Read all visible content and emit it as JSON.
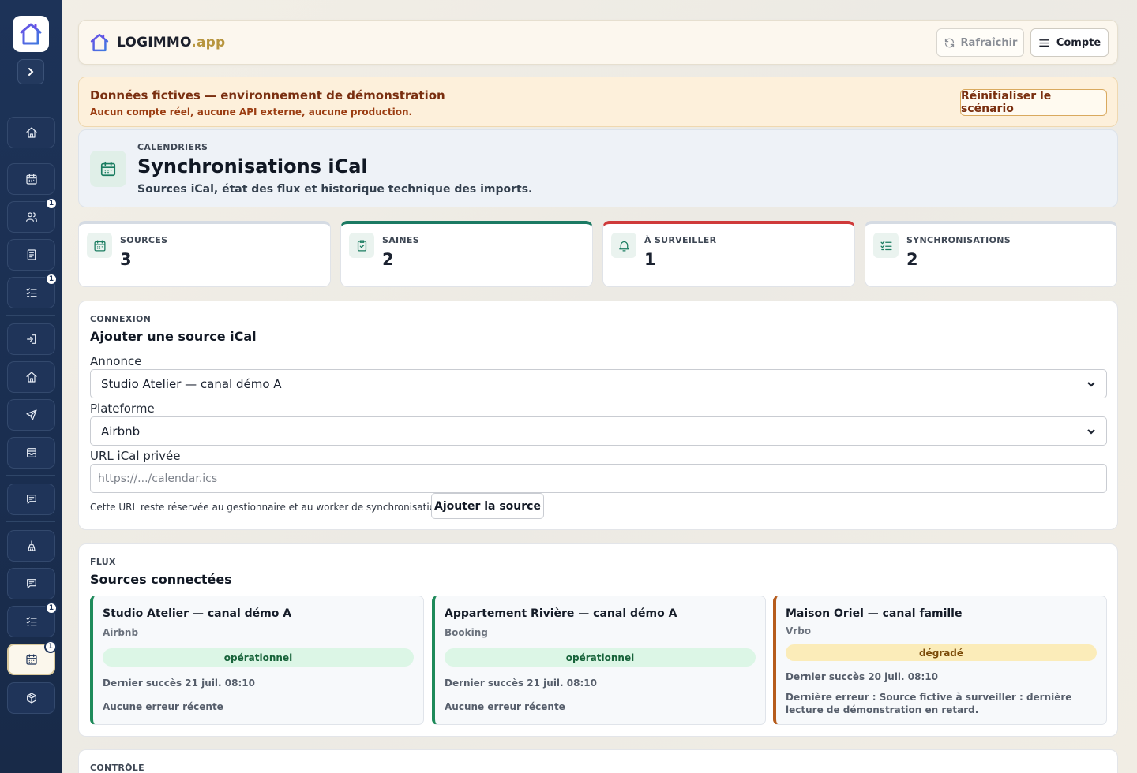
{
  "app": {
    "brand_main": "LOGIMMO",
    "brand_suffix": ".app"
  },
  "header": {
    "refresh_label": "Rafraîchir",
    "account_label": "Compte"
  },
  "sidebar": {
    "items": [
      {
        "icon": "home-icon",
        "badge": ""
      },
      {
        "icon": "calendar-icon",
        "badge": ""
      },
      {
        "icon": "users-icon",
        "badge": "1"
      },
      {
        "icon": "document-icon",
        "badge": ""
      },
      {
        "icon": "checklist-icon",
        "badge": "1"
      },
      {
        "icon": "login-icon",
        "badge": ""
      },
      {
        "icon": "home-icon",
        "badge": ""
      },
      {
        "icon": "send-icon",
        "badge": ""
      },
      {
        "icon": "inbox-icon",
        "badge": ""
      },
      {
        "icon": "message-icon",
        "badge": ""
      },
      {
        "icon": "cleaning-icon",
        "badge": ""
      },
      {
        "icon": "message-icon",
        "badge": ""
      },
      {
        "icon": "checklist-icon",
        "badge": "1"
      },
      {
        "icon": "calendar-icon",
        "badge": "1",
        "active": true
      },
      {
        "icon": "package-icon",
        "badge": ""
      }
    ]
  },
  "demo": {
    "title": "Données fictives — environnement de démonstration",
    "subtitle": "Aucun compte réel, aucune API externe, aucune production.",
    "reset_label": "Réinitialiser le scénario"
  },
  "page": {
    "eyebrow": "CALENDRIERS",
    "title": "Synchronisations iCal",
    "description": "Sources iCal, état des flux et historique technique des imports."
  },
  "stats": [
    {
      "label": "SOURCES",
      "value": "3",
      "icon": "calendar-icon"
    },
    {
      "label": "SAINES",
      "value": "2",
      "icon": "clipboard-check-icon"
    },
    {
      "label": "À SURVEILLER",
      "value": "1",
      "icon": "bell-icon"
    },
    {
      "label": "SYNCHRONISATIONS",
      "value": "2",
      "icon": "checklist-icon"
    }
  ],
  "connexion": {
    "eyebrow": "CONNEXION",
    "title": "Ajouter une source iCal",
    "listing_label": "Annonce",
    "listing_value": "Studio Atelier — canal démo A",
    "platform_label": "Plateforme",
    "platform_value": "Airbnb",
    "url_label": "URL iCal privée",
    "url_placeholder": "https://.../calendar.ics",
    "hint": "Cette URL reste réservée au gestionnaire et au worker de synchronisation.",
    "add_label": "Ajouter la source"
  },
  "flux": {
    "eyebrow": "FLUX",
    "title": "Sources connectées",
    "sources": [
      {
        "name": "Studio Atelier — canal démo A",
        "platform": "Airbnb",
        "status": "opérationnel",
        "last_success": "Dernier succès 21 juil. 08:10",
        "error": "Aucune erreur récente"
      },
      {
        "name": "Appartement Rivière — canal démo A",
        "platform": "Booking",
        "status": "opérationnel",
        "last_success": "Dernier succès 21 juil. 08:10",
        "error": "Aucune erreur récente"
      },
      {
        "name": "Maison Oriel — canal famille",
        "platform": "Vrbo",
        "status": "dégradé",
        "last_success": "Dernier succès 20 juil. 08:10",
        "error": "Dernière erreur : Source fictive à surveiller : dernière lecture de démonstration en retard."
      }
    ]
  },
  "controle": {
    "eyebrow": "CONTRÔLE"
  },
  "colors": {
    "sidebar": "#1d3358",
    "accent_green": "#1b7a63",
    "alert_red": "#cf3a3a",
    "warn_orange": "#b65c1d"
  }
}
